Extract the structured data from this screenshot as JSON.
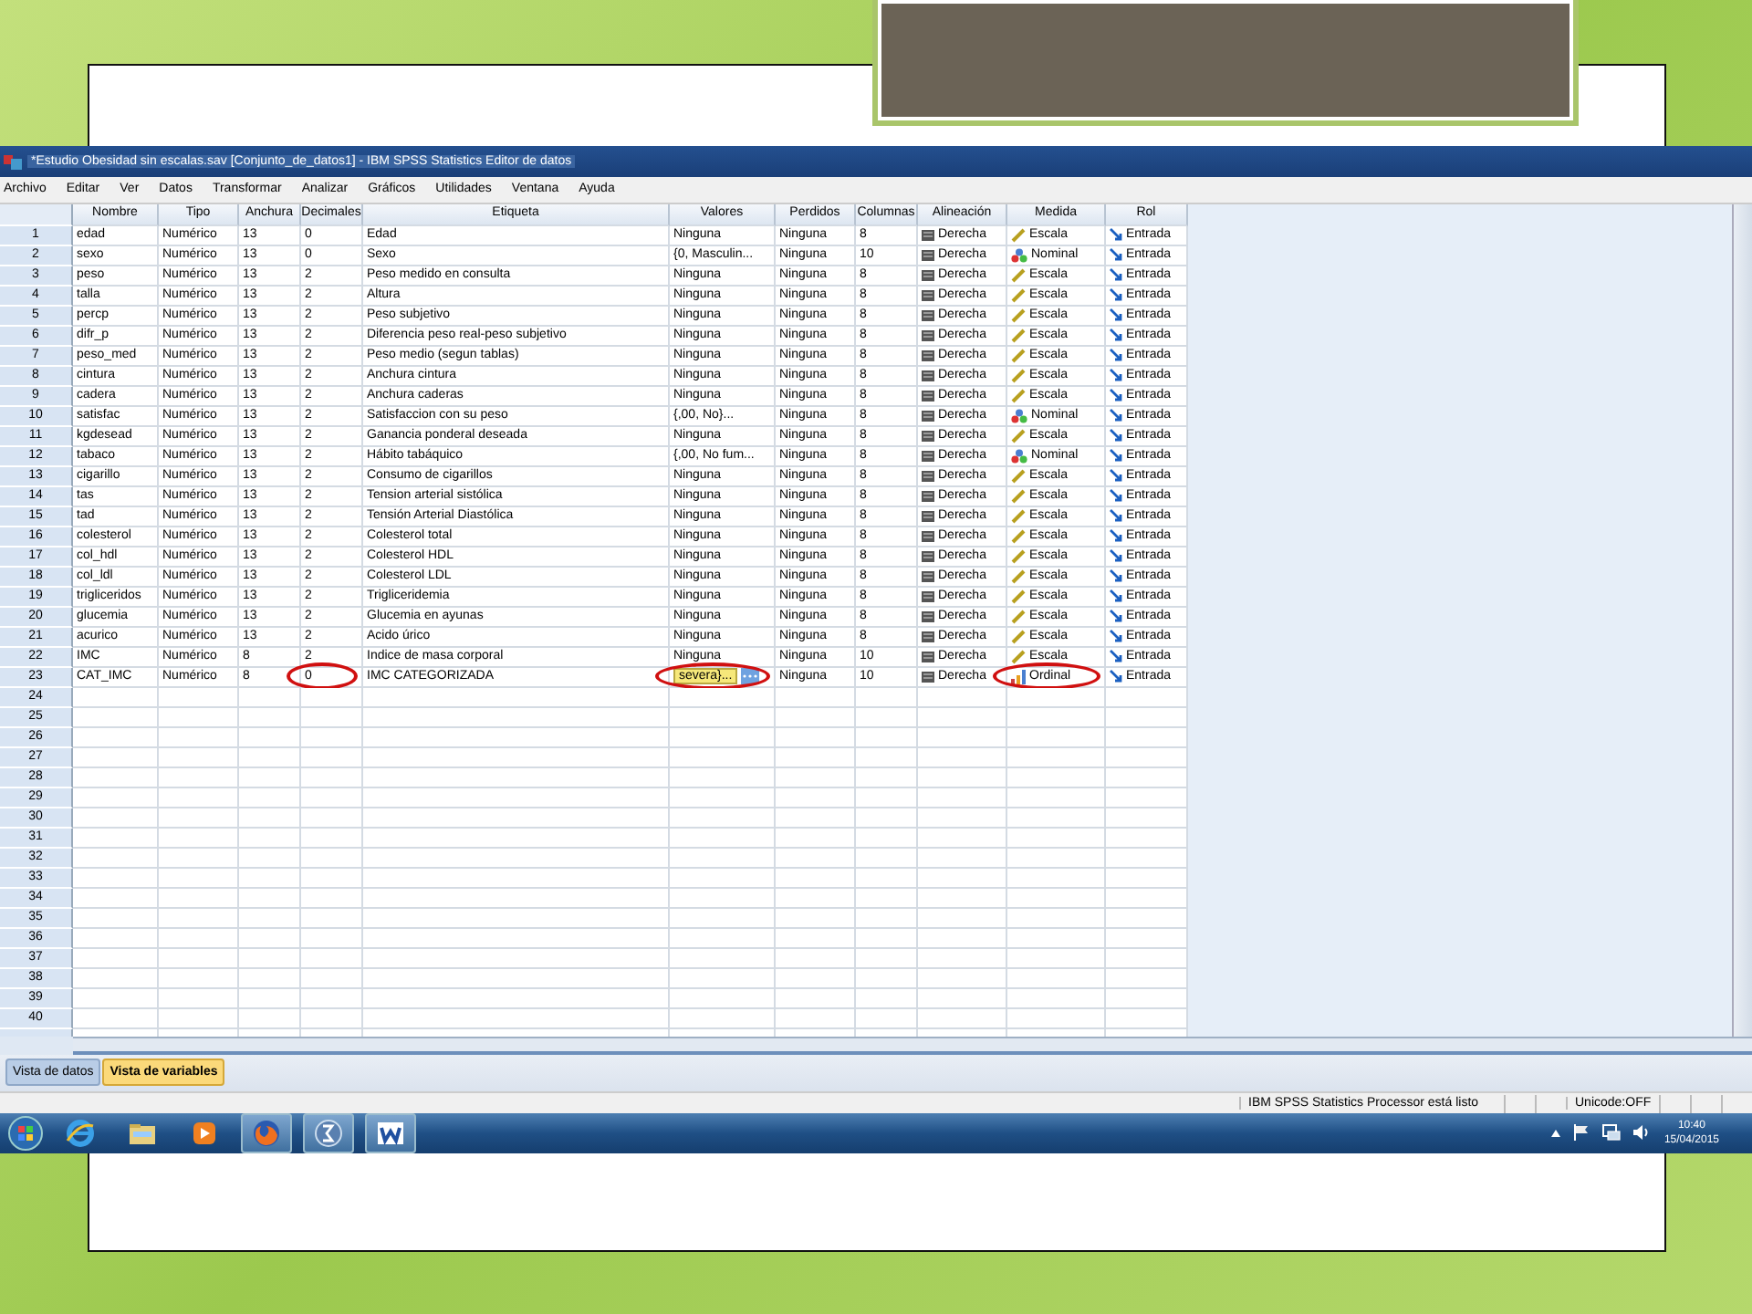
{
  "window": {
    "title": "*Estudio Obesidad sin escalas.sav [Conjunto_de_datos1] - IBM SPSS Statistics Editor de datos"
  },
  "menu": [
    "Archivo",
    "Editar",
    "Ver",
    "Datos",
    "Transformar",
    "Analizar",
    "Gráficos",
    "Utilidades",
    "Ventana",
    "Ayuda"
  ],
  "table": {
    "columns": [
      {
        "label": "Nombre",
        "circled": false
      },
      {
        "label": "Tipo",
        "circled": false
      },
      {
        "label": "Anchura",
        "circled": false
      },
      {
        "label": "Decimales",
        "circled": true
      },
      {
        "label": "Etiqueta",
        "circled": false
      },
      {
        "label": "Valores",
        "circled": true
      },
      {
        "label": "Perdidos",
        "circled": false
      },
      {
        "label": "Columnas",
        "circled": false
      },
      {
        "label": "Alineación",
        "circled": false
      },
      {
        "label": "Medida",
        "circled": true
      },
      {
        "label": "Rol",
        "circled": false
      }
    ],
    "rows": [
      {
        "n": "1",
        "kind": "scale",
        "marked": false,
        "editing": false,
        "cells": [
          "edad",
          "Numérico",
          "13",
          "0",
          "Edad",
          "Ninguna",
          "Ninguna",
          "8",
          "Derecha",
          "Escala",
          "Entrada"
        ]
      },
      {
        "n": "2",
        "kind": "nominal",
        "marked": false,
        "editing": false,
        "cells": [
          "sexo",
          "Numérico",
          "13",
          "0",
          "Sexo",
          "{0, Masculin...",
          "Ninguna",
          "10",
          "Derecha",
          "Nominal",
          "Entrada"
        ]
      },
      {
        "n": "3",
        "kind": "scale",
        "marked": false,
        "editing": false,
        "cells": [
          "peso",
          "Numérico",
          "13",
          "2",
          "Peso medido en consulta",
          "Ninguna",
          "Ninguna",
          "8",
          "Derecha",
          "Escala",
          "Entrada"
        ]
      },
      {
        "n": "4",
        "kind": "scale",
        "marked": false,
        "editing": false,
        "cells": [
          "talla",
          "Numérico",
          "13",
          "2",
          "Altura",
          "Ninguna",
          "Ninguna",
          "8",
          "Derecha",
          "Escala",
          "Entrada"
        ]
      },
      {
        "n": "5",
        "kind": "scale",
        "marked": false,
        "editing": false,
        "cells": [
          "percp",
          "Numérico",
          "13",
          "2",
          "Peso subjetivo",
          "Ninguna",
          "Ninguna",
          "8",
          "Derecha",
          "Escala",
          "Entrada"
        ]
      },
      {
        "n": "6",
        "kind": "scale",
        "marked": false,
        "editing": false,
        "cells": [
          "difr_p",
          "Numérico",
          "13",
          "2",
          "Diferencia peso real-peso subjetivo",
          "Ninguna",
          "Ninguna",
          "8",
          "Derecha",
          "Escala",
          "Entrada"
        ]
      },
      {
        "n": "7",
        "kind": "scale",
        "marked": false,
        "editing": false,
        "cells": [
          "peso_med",
          "Numérico",
          "13",
          "2",
          "Peso medio (segun tablas)",
          "Ninguna",
          "Ninguna",
          "8",
          "Derecha",
          "Escala",
          "Entrada"
        ]
      },
      {
        "n": "8",
        "kind": "scale",
        "marked": false,
        "editing": false,
        "cells": [
          "cintura",
          "Numérico",
          "13",
          "2",
          "Anchura cintura",
          "Ninguna",
          "Ninguna",
          "8",
          "Derecha",
          "Escala",
          "Entrada"
        ]
      },
      {
        "n": "9",
        "kind": "scale",
        "marked": false,
        "editing": false,
        "cells": [
          "cadera",
          "Numérico",
          "13",
          "2",
          "Anchura caderas",
          "Ninguna",
          "Ninguna",
          "8",
          "Derecha",
          "Escala",
          "Entrada"
        ]
      },
      {
        "n": "10",
        "kind": "nominal",
        "marked": false,
        "editing": false,
        "cells": [
          "satisfac",
          "Numérico",
          "13",
          "2",
          "Satisfaccion con su peso",
          "{,00, No}...",
          "Ninguna",
          "8",
          "Derecha",
          "Nominal",
          "Entrada"
        ]
      },
      {
        "n": "11",
        "kind": "scale",
        "marked": false,
        "editing": false,
        "cells": [
          "kgdesead",
          "Numérico",
          "13",
          "2",
          "Ganancia ponderal deseada",
          "Ninguna",
          "Ninguna",
          "8",
          "Derecha",
          "Escala",
          "Entrada"
        ]
      },
      {
        "n": "12",
        "kind": "nominal",
        "marked": false,
        "editing": false,
        "cells": [
          "tabaco",
          "Numérico",
          "13",
          "2",
          "Hábito tabáquico",
          "{,00, No fum...",
          "Ninguna",
          "8",
          "Derecha",
          "Nominal",
          "Entrada"
        ]
      },
      {
        "n": "13",
        "kind": "scale",
        "marked": false,
        "editing": false,
        "cells": [
          "cigarillo",
          "Numérico",
          "13",
          "2",
          "Consumo de cigarillos",
          "Ninguna",
          "Ninguna",
          "8",
          "Derecha",
          "Escala",
          "Entrada"
        ]
      },
      {
        "n": "14",
        "kind": "scale",
        "marked": false,
        "editing": false,
        "cells": [
          "tas",
          "Numérico",
          "13",
          "2",
          "Tension arterial sistólica",
          "Ninguna",
          "Ninguna",
          "8",
          "Derecha",
          "Escala",
          "Entrada"
        ]
      },
      {
        "n": "15",
        "kind": "scale",
        "marked": false,
        "editing": false,
        "cells": [
          "tad",
          "Numérico",
          "13",
          "2",
          "Tensión Arterial Diastólica",
          "Ninguna",
          "Ninguna",
          "8",
          "Derecha",
          "Escala",
          "Entrada"
        ]
      },
      {
        "n": "16",
        "kind": "scale",
        "marked": false,
        "editing": false,
        "cells": [
          "colesterol",
          "Numérico",
          "13",
          "2",
          "Colesterol total",
          "Ninguna",
          "Ninguna",
          "8",
          "Derecha",
          "Escala",
          "Entrada"
        ]
      },
      {
        "n": "17",
        "kind": "scale",
        "marked": false,
        "editing": false,
        "cells": [
          "col_hdl",
          "Numérico",
          "13",
          "2",
          "Colesterol HDL",
          "Ninguna",
          "Ninguna",
          "8",
          "Derecha",
          "Escala",
          "Entrada"
        ]
      },
      {
        "n": "18",
        "kind": "scale",
        "marked": false,
        "editing": false,
        "cells": [
          "col_ldl",
          "Numérico",
          "13",
          "2",
          "Colesterol LDL",
          "Ninguna",
          "Ninguna",
          "8",
          "Derecha",
          "Escala",
          "Entrada"
        ]
      },
      {
        "n": "19",
        "kind": "scale",
        "marked": false,
        "editing": false,
        "cells": [
          "trigliceridos",
          "Numérico",
          "13",
          "2",
          "Trigliceridemia",
          "Ninguna",
          "Ninguna",
          "8",
          "Derecha",
          "Escala",
          "Entrada"
        ]
      },
      {
        "n": "20",
        "kind": "scale",
        "marked": false,
        "editing": false,
        "cells": [
          "glucemia",
          "Numérico",
          "13",
          "2",
          "Glucemia en ayunas",
          "Ninguna",
          "Ninguna",
          "8",
          "Derecha",
          "Escala",
          "Entrada"
        ]
      },
      {
        "n": "21",
        "kind": "scale",
        "marked": false,
        "editing": false,
        "cells": [
          "acurico",
          "Numérico",
          "13",
          "2",
          "Acido úrico",
          "Ninguna",
          "Ninguna",
          "8",
          "Derecha",
          "Escala",
          "Entrada"
        ]
      },
      {
        "n": "22",
        "kind": "scale",
        "marked": false,
        "editing": false,
        "cells": [
          "IMC",
          "Numérico",
          "8",
          "2",
          "Indice de masa corporal",
          "Ninguna",
          "Ninguna",
          "10",
          "Derecha",
          "Escala",
          "Entrada"
        ]
      },
      {
        "n": "23",
        "kind": "ordinal",
        "marked": true,
        "editing": true,
        "cells": [
          "CAT_IMC",
          "Numérico",
          "8",
          "0",
          "IMC CATEGORIZADA",
          "severa}...",
          "Ninguna",
          "10",
          "Derecha",
          "Ordinal",
          "Entrada"
        ]
      }
    ],
    "empty_rows": [
      "24",
      "25",
      "26",
      "27",
      "28",
      "29",
      "30",
      "31",
      "32",
      "33",
      "34",
      "35",
      "36",
      "37",
      "38",
      "39",
      "40"
    ]
  },
  "tabs": [
    {
      "label": "Vista de datos",
      "selected": false
    },
    {
      "label": "Vista de variables",
      "selected": true
    }
  ],
  "status_bar": {
    "processor": "IBM SPSS Statistics Processor está listo",
    "unicode": "Unicode:OFF"
  },
  "taskbar": {
    "apps": [
      {
        "kind": "browser-e",
        "open": false
      },
      {
        "kind": "folder",
        "open": false
      },
      {
        "kind": "media",
        "open": false
      },
      {
        "kind": "browser-fox",
        "open": true
      },
      {
        "kind": "sigma",
        "open": true
      },
      {
        "kind": "word",
        "open": true
      }
    ],
    "time": "10:40",
    "date": "15/04/2015"
  }
}
